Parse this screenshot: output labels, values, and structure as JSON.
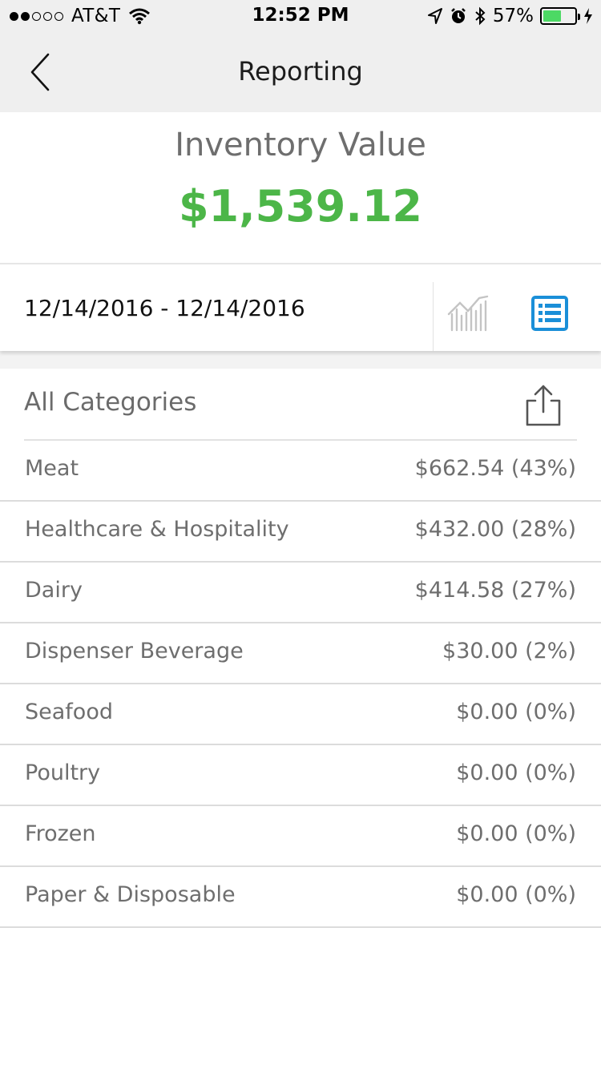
{
  "status_bar": {
    "carrier": "AT&T",
    "time": "12:52 PM",
    "battery_percent": "57%",
    "battery_level": 0.57,
    "signal_bars_filled": 2,
    "signal_bars_total": 5
  },
  "nav": {
    "title": "Reporting",
    "back_icon": "chevron-left-icon"
  },
  "summary": {
    "label": "Inventory Value",
    "value": "$1,539.12",
    "value_color": "#4cb648"
  },
  "date_bar": {
    "range": "12/14/2016 - 12/14/2016",
    "chart_icon": "bar-chart-icon",
    "list_icon": "list-view-icon",
    "active_color": "#1a8fd8"
  },
  "categories_header": {
    "label": "All Categories",
    "share_icon": "share-icon"
  },
  "categories": [
    {
      "name": "Meat",
      "value": "$662.54 (43%)"
    },
    {
      "name": "Healthcare & Hospitality",
      "value": "$432.00 (28%)"
    },
    {
      "name": "Dairy",
      "value": "$414.58 (27%)"
    },
    {
      "name": "Dispenser Beverage",
      "value": "$30.00 (2%)"
    },
    {
      "name": "Seafood",
      "value": "$0.00 (0%)"
    },
    {
      "name": "Poultry",
      "value": "$0.00 (0%)"
    },
    {
      "name": "Frozen",
      "value": "$0.00 (0%)"
    },
    {
      "name": "Paper & Disposable",
      "value": "$0.00 (0%)"
    }
  ]
}
